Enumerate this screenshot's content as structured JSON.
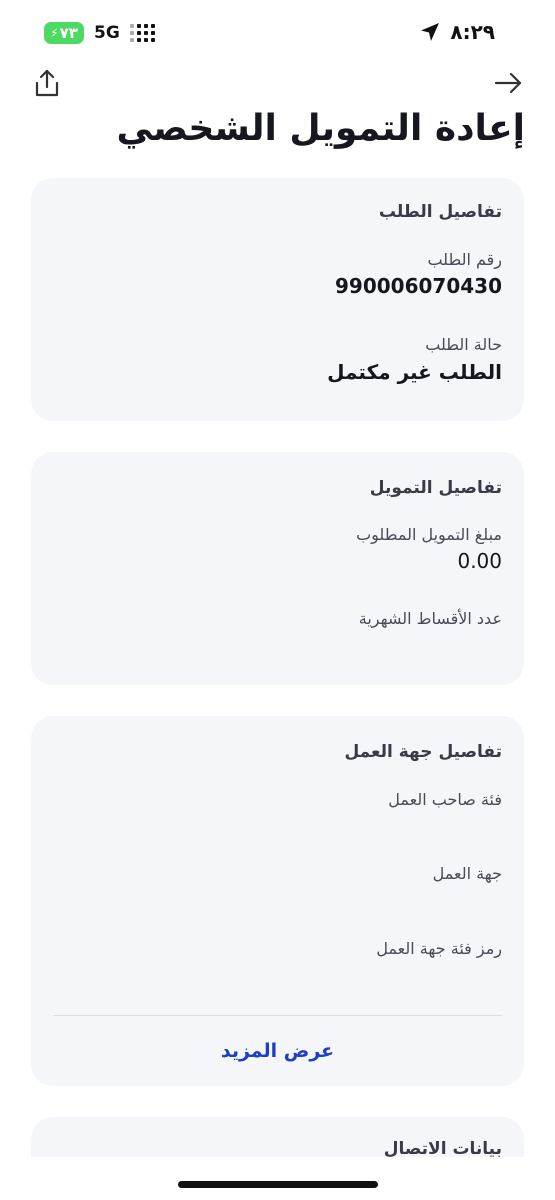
{
  "status_bar": {
    "battery": "٧٣",
    "network": "5G",
    "time": "٨:٢٩"
  },
  "header": {
    "title": "إعادة التمويل الشخصي"
  },
  "request_details": {
    "title": "تفاصيل الطلب",
    "request_number_label": "رقم الطلب",
    "request_number": "990006070430",
    "request_status_label": "حالة الطلب",
    "request_status": "الطلب غير مكتمل"
  },
  "finance_details": {
    "title": "تفاصيل التمويل",
    "amount_label": "مبلغ التمويل المطلوب",
    "amount": "0.00",
    "installments_label": "عدد الأقساط الشهرية"
  },
  "employer_details": {
    "title": "تفاصيل جهة العمل",
    "employer_category_label": "فئة صاحب العمل",
    "employer_label": "جهة العمل",
    "employer_code_label": "رمز فئة جهة العمل",
    "show_more": "عرض المزيد"
  },
  "contact_details": {
    "title": "بيانات الاتصال"
  },
  "icons": {
    "share": "share-icon",
    "back": "arrow-right-icon",
    "location": "location-arrow-icon"
  }
}
